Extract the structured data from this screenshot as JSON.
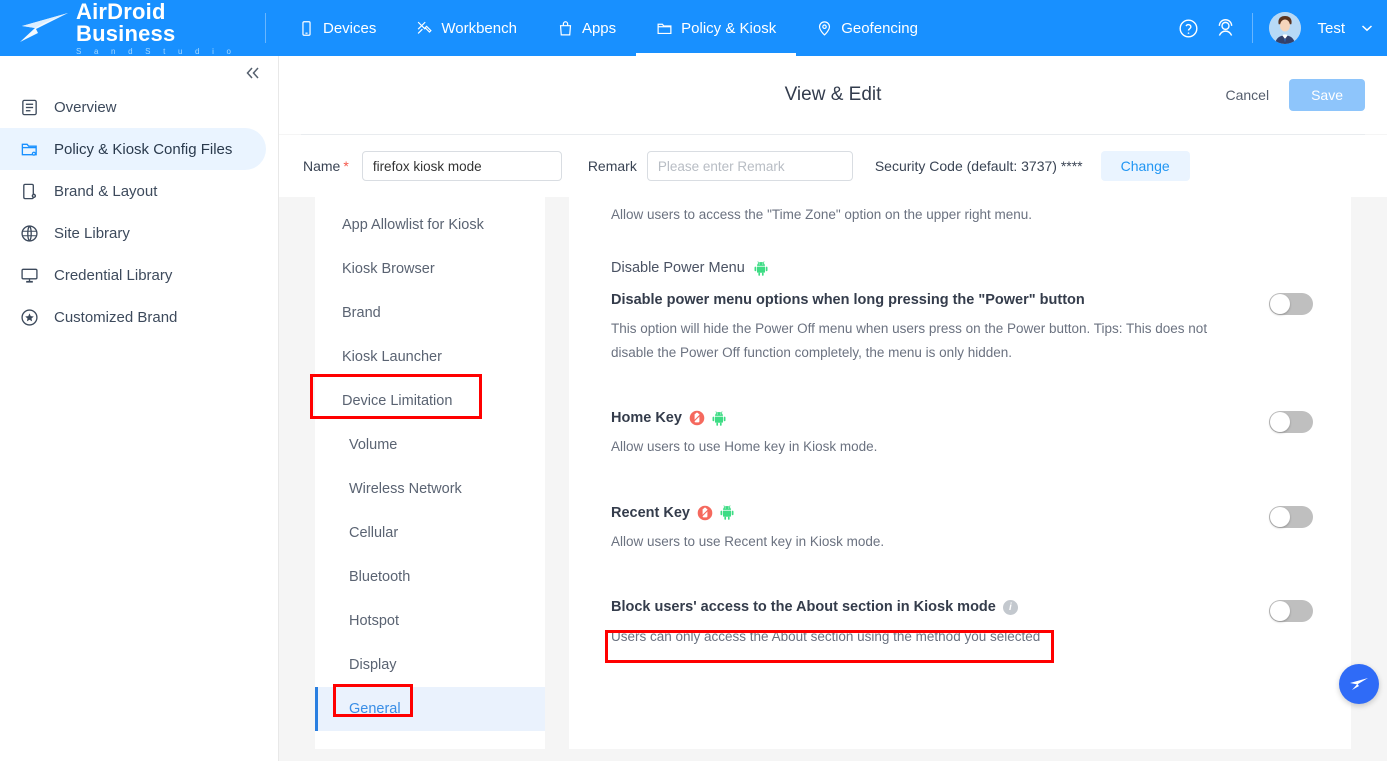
{
  "topbar": {
    "logo_title": "AirDroid Business",
    "logo_subtitle": "S a n d   S t u d i o",
    "nav": [
      {
        "label": "Devices",
        "icon": "phone-icon",
        "active": false
      },
      {
        "label": "Workbench",
        "icon": "tools-icon",
        "active": false
      },
      {
        "label": "Apps",
        "icon": "bag-icon",
        "active": false
      },
      {
        "label": "Policy & Kiosk",
        "icon": "folder-icon",
        "active": true
      },
      {
        "label": "Geofencing",
        "icon": "location-pin-icon",
        "active": false
      }
    ],
    "help_icon": "question-circle-icon",
    "support_icon": "headset-icon",
    "user_name": "Test",
    "chevron_icon": "chevron-down-icon"
  },
  "sidebar": {
    "collapse_icon": "double-chevron-left-icon",
    "items": [
      {
        "label": "Overview",
        "icon": "document-icon",
        "active": false
      },
      {
        "label": "Policy & Kiosk Config Files",
        "icon": "folder-gear-icon",
        "active": true
      },
      {
        "label": "Brand & Layout",
        "icon": "phone-gear-icon",
        "active": false
      },
      {
        "label": "Site Library",
        "icon": "globe-icon",
        "active": false
      },
      {
        "label": "Credential Library",
        "icon": "monitor-icon",
        "active": false
      },
      {
        "label": "Customized Brand",
        "icon": "star-circle-icon",
        "active": false
      }
    ]
  },
  "panel": {
    "title": "View & Edit",
    "cancel_label": "Cancel",
    "save_label": "Save",
    "form": {
      "name_label": "Name",
      "name_required_mark": "*",
      "name_value": "firefox kiosk mode",
      "remark_label": "Remark",
      "remark_placeholder": "Please enter Remark",
      "security_code_label": "Security Code (default: 3737) ****",
      "change_label": "Change"
    }
  },
  "subnav": {
    "items": [
      {
        "label": "App Allowlist for Kiosk",
        "level": 1,
        "active": false
      },
      {
        "label": "Kiosk Browser",
        "level": 1,
        "active": false
      },
      {
        "label": "Brand",
        "level": 1,
        "active": false
      },
      {
        "label": "Kiosk Launcher",
        "level": 1,
        "active": false
      },
      {
        "label": "Device Limitation",
        "level": 1,
        "active": false
      },
      {
        "label": "Volume",
        "level": 2,
        "active": false
      },
      {
        "label": "Wireless Network",
        "level": 2,
        "active": false
      },
      {
        "label": "Cellular",
        "level": 2,
        "active": false
      },
      {
        "label": "Bluetooth",
        "level": 2,
        "active": false
      },
      {
        "label": "Hotspot",
        "level": 2,
        "active": false
      },
      {
        "label": "Display",
        "level": 2,
        "active": false
      },
      {
        "label": "General",
        "level": 2,
        "active": true
      }
    ]
  },
  "content": {
    "lead_text": "Allow users to access the \"Time Zone\" option on the upper right menu.",
    "sections": [
      {
        "label": "Disable Power Menu",
        "label_badges": [
          "android-robot-icon"
        ],
        "option_title": "Disable power menu options when long pressing the \"Power\" button",
        "option_badges": [],
        "option_desc": "This option will hide the Power Off menu when users press on the Power button. Tips: This does not disable the Power Off function completely, the menu is only hidden.",
        "toggle_on": false
      },
      {
        "label": "",
        "label_badges": [],
        "option_title": "Home Key",
        "option_badges": [
          "red-device-badge-icon",
          "android-robot-icon"
        ],
        "option_desc": "Allow users to use Home key in Kiosk mode.",
        "toggle_on": false
      },
      {
        "label": "",
        "label_badges": [],
        "option_title": "Recent Key",
        "option_badges": [
          "red-device-badge-icon",
          "android-robot-icon"
        ],
        "option_desc": "Allow users to use Recent key in Kiosk mode.",
        "toggle_on": false
      },
      {
        "label": "",
        "label_badges": [],
        "option_title": "Block users' access to the About section in Kiosk mode",
        "option_badges": [
          "info-icon"
        ],
        "option_desc": "Users can only access the About section using the method you selected",
        "toggle_on": false
      }
    ]
  },
  "fab": {
    "icon": "paper-plane-icon"
  },
  "annotations": {
    "highlight_color": "#ff0000",
    "boxes": [
      "Device Limitation",
      "General",
      "Block users' access to the About section in Kiosk mode"
    ]
  },
  "colors": {
    "brand_blue": "#1890ff",
    "active_pill": "#eaf4ff",
    "link_blue": "#2196f3",
    "save_disabled": "#8ec5fb",
    "toggle_off": "#bfbfbf",
    "android_green": "#3ddc84",
    "badge_red": "#f5695e"
  }
}
